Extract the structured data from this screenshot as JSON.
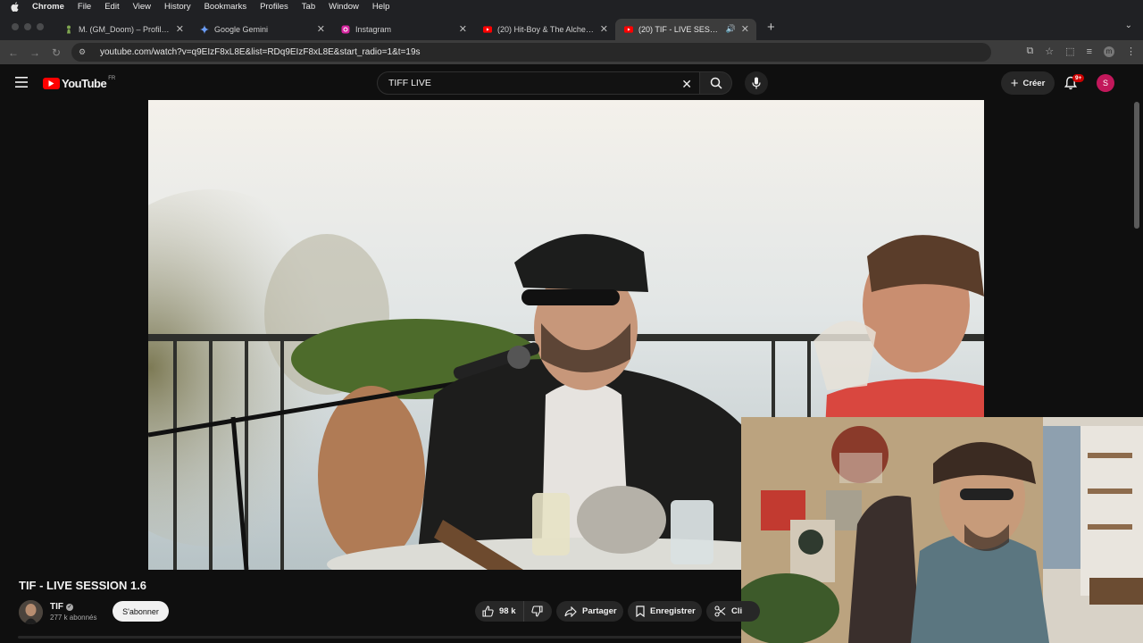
{
  "menubar": {
    "app": "Chrome",
    "items": [
      "File",
      "Edit",
      "View",
      "History",
      "Bookmarks",
      "Profiles",
      "Tab",
      "Window",
      "Help"
    ]
  },
  "tabs": [
    {
      "title": "M. (GM_Doom) – Profil - Che",
      "icon": "chess-pawn-icon",
      "active": false
    },
    {
      "title": "Google Gemini",
      "icon": "gemini-sparkle-icon",
      "active": false
    },
    {
      "title": "Instagram",
      "icon": "instagram-icon",
      "active": false
    },
    {
      "title": "(20) Hit-Boy & The Alchemist",
      "icon": "youtube-icon",
      "active": false
    },
    {
      "title": "(20) TIF - LIVE SESSION 1.6",
      "icon": "youtube-icon",
      "active": true
    }
  ],
  "address": {
    "url": "youtube.com/watch?v=q9EIzF8xL8E&list=RDq9EIzF8xL8E&start_radio=1&t=19s"
  },
  "youtube": {
    "logo_text": "YouTube",
    "region": "FR",
    "search_value": "TIFF LIVE",
    "create_label": "Créer",
    "notif_badge": "9+",
    "account_initial": "S"
  },
  "video": {
    "title": "TIF - LIVE SESSION 1.6",
    "channel": "TIF",
    "subscribers": "277 k abonnés",
    "subscribe_label": "S'abonner",
    "likes": "98 k",
    "share_label": "Partager",
    "save_label": "Enregistrer",
    "clip_label": "Cli"
  },
  "colors": {
    "yt_red": "#ff0000",
    "background": "#0f0f0f",
    "account": "#c2185b"
  }
}
